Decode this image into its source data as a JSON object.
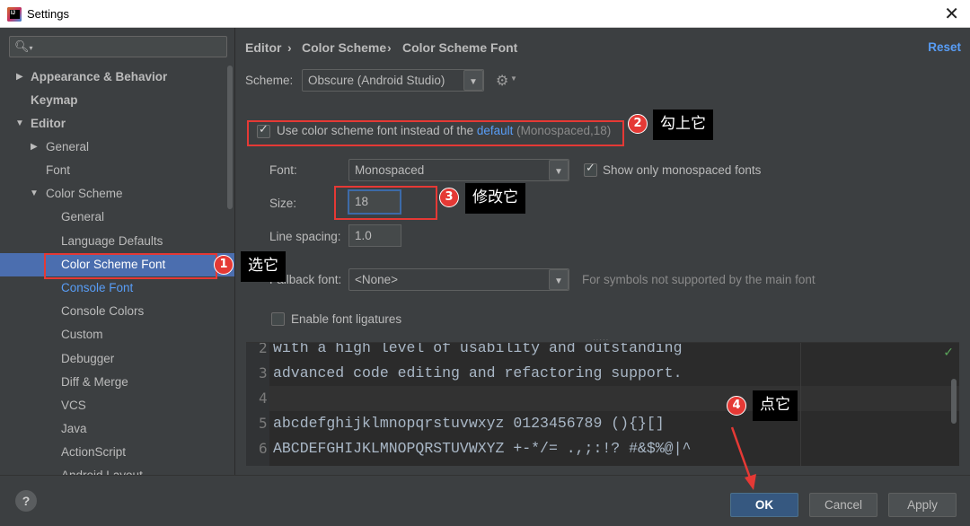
{
  "window": {
    "title": "Settings"
  },
  "sidebar": {
    "search_placeholder": "",
    "items": [
      {
        "label": "Appearance & Behavior"
      },
      {
        "label": "Keymap"
      },
      {
        "label": "Editor"
      },
      {
        "label": "General"
      },
      {
        "label": "Font"
      },
      {
        "label": "Color Scheme"
      },
      {
        "label": "General"
      },
      {
        "label": "Language Defaults"
      },
      {
        "label": "Color Scheme Font"
      },
      {
        "label": "Console Font"
      },
      {
        "label": "Console Colors"
      },
      {
        "label": "Custom"
      },
      {
        "label": "Debugger"
      },
      {
        "label": "Diff & Merge"
      },
      {
        "label": "VCS"
      },
      {
        "label": "Java"
      },
      {
        "label": "ActionScript"
      },
      {
        "label": "Android Layout"
      }
    ]
  },
  "breadcrumb": {
    "part1": "Editor",
    "part2": "Color Scheme",
    "part3": "Color Scheme Font",
    "sep": "›"
  },
  "reset_label": "Reset",
  "scheme": {
    "label": "Scheme:",
    "value": "Obscure (Android Studio)"
  },
  "use_scheme_font": {
    "text_before": "Use color scheme font instead of the ",
    "link": "default",
    "hint": " (Monospaced,18)"
  },
  "font": {
    "label": "Font:",
    "value": "Monospaced",
    "show_mono_label": "Show only monospaced fonts"
  },
  "size": {
    "label": "Size:",
    "value": "18"
  },
  "line_spacing": {
    "label": "Line spacing:",
    "value": "1.0"
  },
  "fallback": {
    "label": "Fallback font:",
    "value": "<None>",
    "hint": "For symbols not supported by the main font"
  },
  "ligatures": {
    "label": "Enable font ligatures"
  },
  "preview": {
    "lines": [
      {
        "num": "2",
        "text": "with a high level of usability and outstanding"
      },
      {
        "num": "3",
        "text": "advanced code editing and refactoring support."
      },
      {
        "num": "4",
        "text": ""
      },
      {
        "num": "5",
        "text": "abcdefghijklmnopqrstuvwxyz 0123456789 (){}[]"
      },
      {
        "num": "6",
        "text": "ABCDEFGHIJKLMNOPQRSTUVWXYZ +-*/= .,;:!? #&$%@|^"
      }
    ]
  },
  "annotations": [
    {
      "num": "1",
      "text": "选它"
    },
    {
      "num": "2",
      "text": "勾上它"
    },
    {
      "num": "3",
      "text": "修改它"
    },
    {
      "num": "4",
      "text": "点它"
    }
  ],
  "buttons": {
    "help": "?",
    "ok": "OK",
    "cancel": "Cancel",
    "apply": "Apply"
  },
  "colors": {
    "selection": "#4b6eaf",
    "link": "#589df6",
    "annotation_red": "#e53935",
    "ok_button": "#365880"
  }
}
